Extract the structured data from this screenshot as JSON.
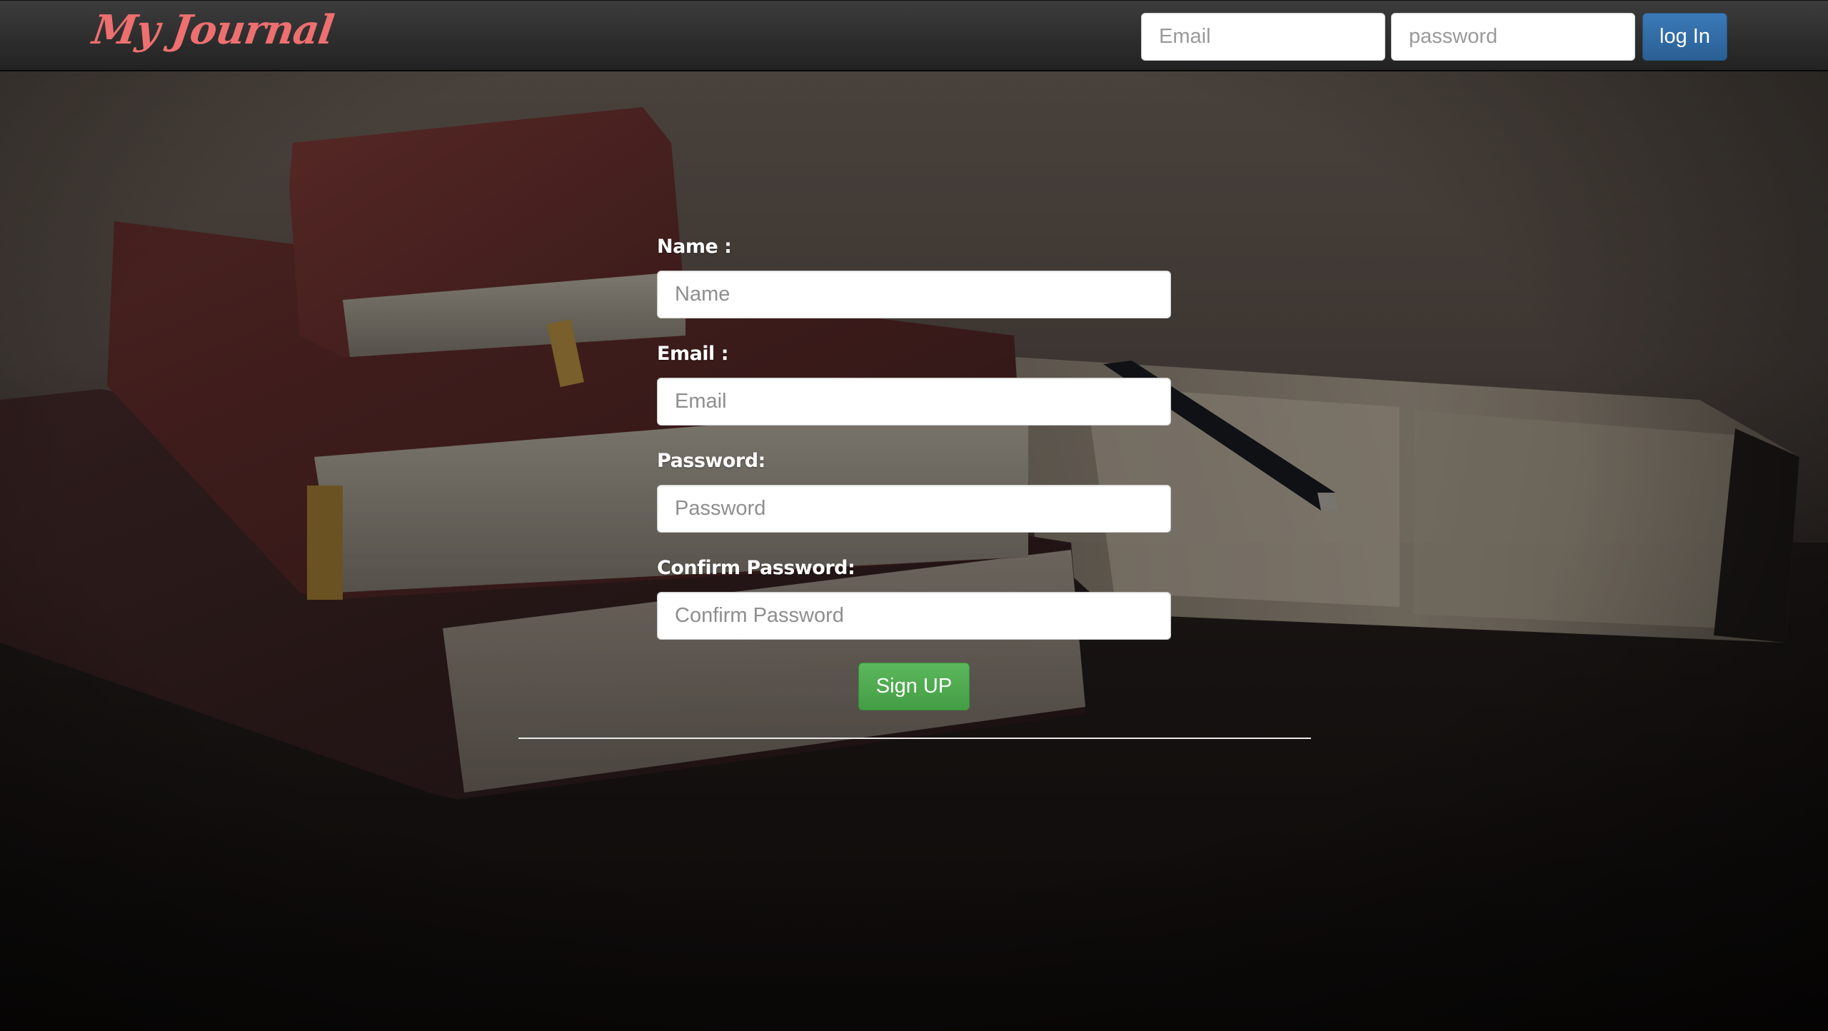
{
  "navbar": {
    "brand": "My Journal",
    "email_placeholder": "Email",
    "password_placeholder": "password",
    "login_label": "log In"
  },
  "signup_form": {
    "name_label": "Name :",
    "name_placeholder": "Name",
    "email_label": "Email :",
    "email_placeholder": "Email",
    "password_label": "Password:",
    "password_placeholder": "Password",
    "confirm_label": "Confirm Password:",
    "confirm_placeholder": "Confirm Password",
    "submit_label": "Sign UP"
  },
  "colors": {
    "brand": "#ee6f6f",
    "navbar": "#2b2b2b",
    "login_button": "#2f6ba5",
    "signup_button": "#4cae4c",
    "label_text": "#ffffff"
  },
  "background": {
    "icon": "books-and-open-notebook-photo"
  }
}
